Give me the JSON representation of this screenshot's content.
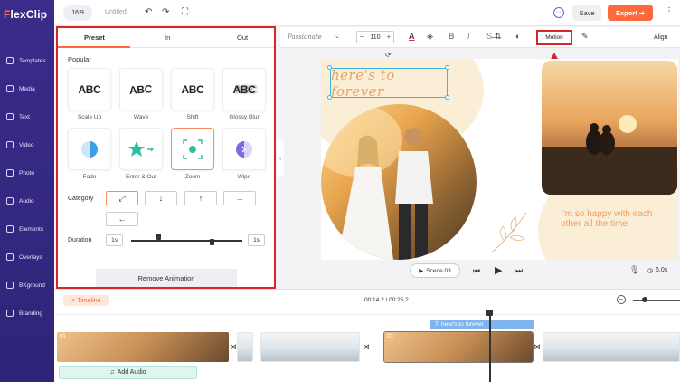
{
  "app": {
    "logo": "FlexClip",
    "logo_first": "F",
    "logo_rest": "lexClip"
  },
  "nav": {
    "items": [
      {
        "label": "Templates",
        "icon": "templates-icon"
      },
      {
        "label": "Media",
        "icon": "media-icon"
      },
      {
        "label": "Text",
        "icon": "text-icon"
      },
      {
        "label": "Video",
        "icon": "video-icon"
      },
      {
        "label": "Photo",
        "icon": "photo-icon"
      },
      {
        "label": "Audio",
        "icon": "audio-icon"
      },
      {
        "label": "Elements",
        "icon": "elements-icon"
      },
      {
        "label": "Overlays",
        "icon": "overlays-icon"
      },
      {
        "label": "BKground",
        "icon": "background-icon"
      },
      {
        "label": "Branding",
        "icon": "branding-icon"
      }
    ]
  },
  "topbar": {
    "ratio": "16:9",
    "project_title": "Untitled",
    "undo": "↶",
    "redo": "↷",
    "fullscreen": "⛶",
    "comment": "···",
    "save": "Save",
    "export": "Export ➜",
    "more": "⋮"
  },
  "panel": {
    "tabs": [
      "Preset",
      "In",
      "Out"
    ],
    "active_tab": "Preset",
    "section": "Popular",
    "presets": [
      {
        "label": "Scale Up",
        "glyph": "ABC"
      },
      {
        "label": "Wave",
        "glyph": "ABC"
      },
      {
        "label": "Shift",
        "glyph": "ABC"
      },
      {
        "label": "Glossy Blur",
        "glyph": "ABC"
      },
      {
        "label": "Fade",
        "glyph": ""
      },
      {
        "label": "Enter & Out",
        "glyph": ""
      },
      {
        "label": "Zoom",
        "glyph": ""
      },
      {
        "label": "Wipe",
        "glyph": ""
      }
    ],
    "selected_preset": "Zoom",
    "category_label": "Category",
    "category_buttons": [
      "⤢",
      "↓",
      "↑",
      "→",
      "←"
    ],
    "duration_label": "Duration",
    "duration_start": "1s",
    "duration_end": "1s",
    "remove_button": "Remove Animation"
  },
  "text_toolbar": {
    "font": "Passionate",
    "font_chevron": "⌄",
    "size": "110",
    "size_minus": "−",
    "size_plus": "+",
    "bold": "B",
    "italic": "I",
    "strike": "S",
    "spacing": "⇅",
    "motion": "Motion",
    "align": "Align"
  },
  "canvas": {
    "title_text": "here's to forever",
    "caption_text": "I'm so happy with each other all the time",
    "rotate": "⟳"
  },
  "playback": {
    "scene": "Scene 03",
    "duration": "6.0s"
  },
  "timeline": {
    "label": "Timeline",
    "time": "00:14.2 / 00:25.2",
    "text_track": "here's to forever",
    "clip_numbers": [
      "01",
      "03"
    ],
    "add_audio": "Add Audio"
  },
  "colors": {
    "accent": "#ff6a3d",
    "nav_bg": "#3a2c8a",
    "highlight_red": "#d9252a",
    "title_color": "#e9a266",
    "selection_blue": "#3fb6e0"
  }
}
